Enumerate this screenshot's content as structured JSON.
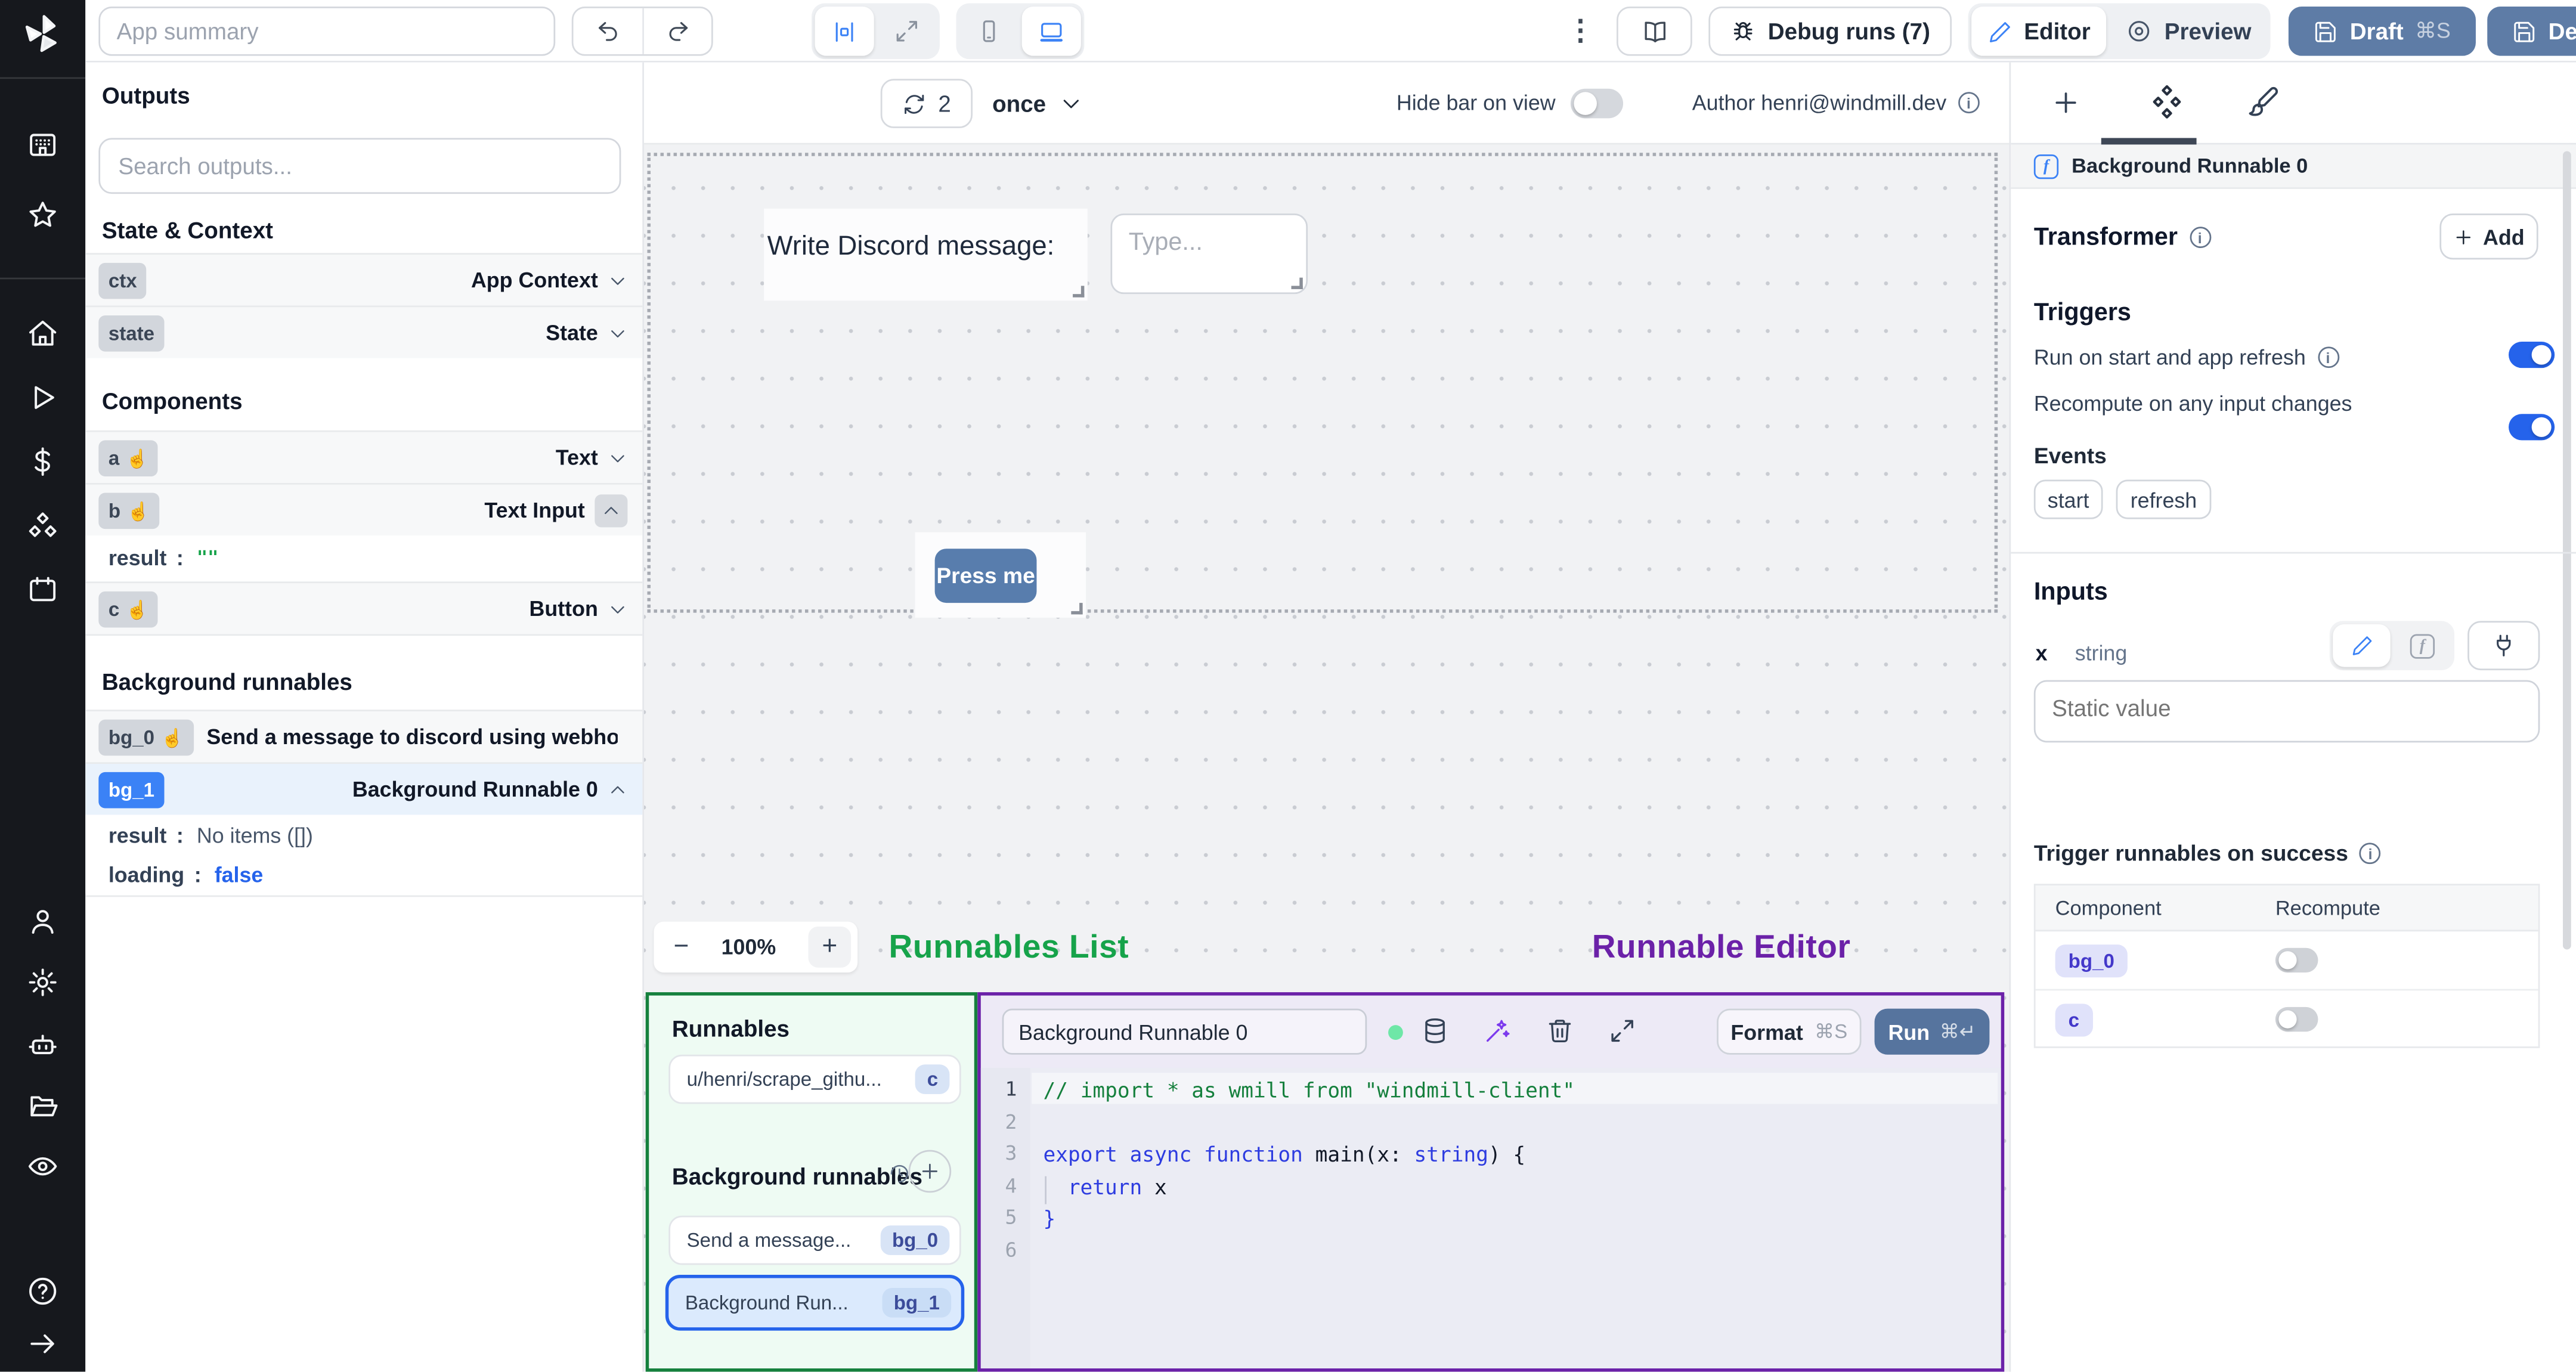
{
  "colors": {
    "accent": "#2563eb",
    "steel_button": "#5e7ca6",
    "annotation_green": "#16a34a",
    "annotation_purple": "#6b21a8",
    "badge_selected_blue": "#3b82f6"
  },
  "topbar": {
    "app_summary_placeholder": "App summary",
    "debug_runs_label": "Debug runs (7)",
    "editor_label": "Editor",
    "preview_label": "Preview",
    "draft_label": "Draft",
    "draft_shortcut": "⌘S",
    "deploy_label": "Deploy"
  },
  "canvas_toolbar": {
    "refresh_count": "2",
    "frequency": "once",
    "hide_bar_label": "Hide bar on view",
    "author_label": "Author henri@windmill.dev"
  },
  "left_panel": {
    "outputs_title": "Outputs",
    "search_placeholder": "Search outputs...",
    "state_context_title": "State & Context",
    "ctx_id": "ctx",
    "ctx_type": "App Context",
    "state_id": "state",
    "state_type": "State",
    "components_title": "Components",
    "a_id": "a",
    "a_type": "Text",
    "b_id": "b",
    "b_type": "Text Input",
    "b_result_key": "result",
    "b_result_sep": ":",
    "b_result_value": "\"\"",
    "c_id": "c",
    "c_type": "Button",
    "bg_title": "Background runnables",
    "bg0_id": "bg_0",
    "bg0_label": "Send a message to discord using webhoo",
    "bg1_id": "bg_1",
    "bg1_type": "Background Runnable 0",
    "bg1_result_key": "result",
    "bg1_result_value": "No items ([])",
    "bg1_loading_key": "loading",
    "bg1_loading_value": "false"
  },
  "canvas": {
    "discord_label": "Write Discord message:",
    "type_placeholder": "Type...",
    "press_me": "Press me",
    "zoom_out": "−",
    "zoom_value": "100%",
    "zoom_in": "+",
    "runnables_list_annotation": "Runnables List",
    "runnable_editor_annotation": "Runnable Editor"
  },
  "runnables_panel": {
    "title": "Runnables",
    "script_name": "u/henri/scrape_githu...",
    "script_badge": "c",
    "bg_section_title": "Background runnables",
    "bg0_name": "Send a message...",
    "bg0_badge": "bg_0",
    "bg1_name": "Background Run...",
    "bg1_badge": "bg_1"
  },
  "editor_panel": {
    "runnable_name": "Background Runnable 0",
    "format_label": "Format",
    "format_shortcut": "⌘S",
    "run_label": "Run",
    "run_shortcut": "⌘↵",
    "line_numbers": [
      "1",
      "2",
      "3",
      "4",
      "5",
      "6"
    ],
    "code": {
      "l1_comment": "// import * as wmill from \"windmill-client\"",
      "l3_kw": "export async function",
      "l3_name": " main(",
      "l3_param": "x: ",
      "l3_type": "string",
      "l3_close": ") {",
      "l4_kw": "return",
      "l4_val": " x",
      "l5": "}"
    }
  },
  "right_panel": {
    "header_title": "Background Runnable 0",
    "transformer_title": "Transformer",
    "add_label": "Add",
    "triggers_title": "Triggers",
    "run_on_start_label": "Run on start and app refresh",
    "recompute_label": "Recompute on any input changes",
    "events_title": "Events",
    "event_start": "start",
    "event_refresh": "refresh",
    "inputs_title": "Inputs",
    "input_name": "x",
    "input_type": "string",
    "static_value_placeholder": "Static value",
    "trigger_success_title": "Trigger runnables on success",
    "table": {
      "col_component": "Component",
      "col_recompute": "Recompute",
      "row1_badge": "bg_0",
      "row2_badge": "c"
    }
  }
}
